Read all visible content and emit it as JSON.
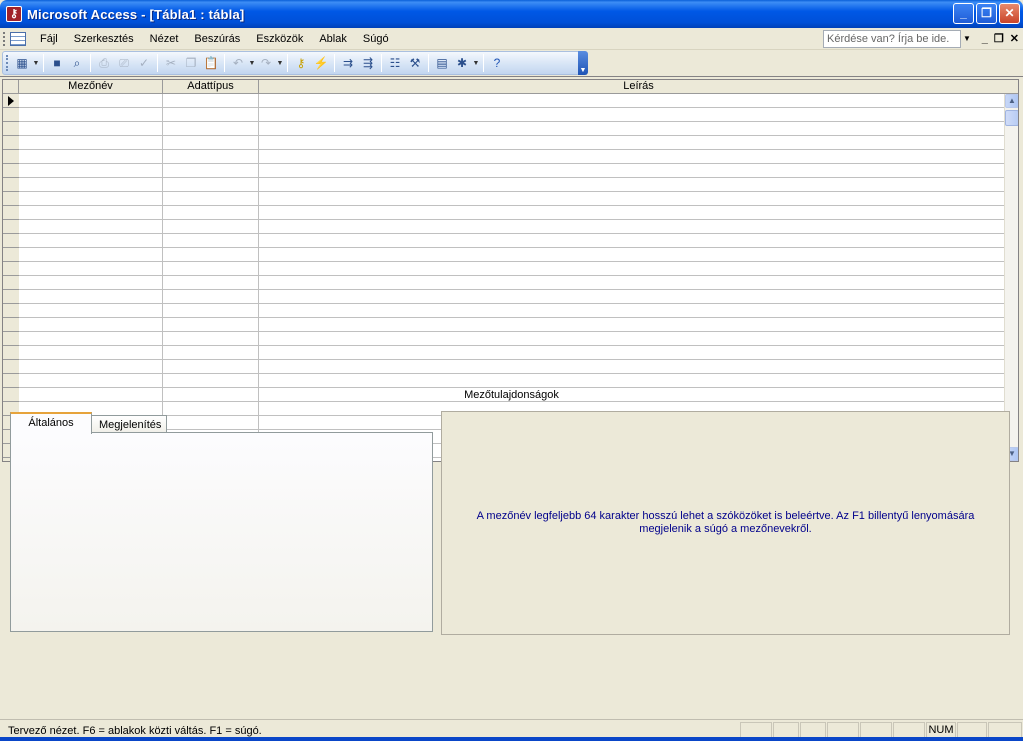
{
  "window": {
    "title": "Microsoft Access - [Tábla1 : tábla]",
    "minimize_label": "_",
    "restore_label": "❐",
    "close_label": "✕"
  },
  "menu": {
    "items": [
      {
        "label": "Fájl"
      },
      {
        "label": "Szerkesztés"
      },
      {
        "label": "Nézet"
      },
      {
        "label": "Beszúrás"
      },
      {
        "label": "Eszközök"
      },
      {
        "label": "Ablak"
      },
      {
        "label": "Súgó"
      }
    ],
    "help_placeholder": "Kérdése van? Írja be ide.",
    "mdi_minimize": "_",
    "mdi_restore": "❐",
    "mdi_close": "✕"
  },
  "toolbar": {
    "icons": [
      "view-icon",
      "save-icon",
      "search-icon",
      "print-icon",
      "print-preview-icon",
      "spelling-icon",
      "cut-icon",
      "copy-icon",
      "paste-icon",
      "undo-icon",
      "redo-icon",
      "primary-key-icon",
      "indexes-icon",
      "insert-rows-icon",
      "delete-rows-icon",
      "properties-icon",
      "build-icon",
      "database-window-icon",
      "new-object-icon",
      "help-icon"
    ]
  },
  "grid": {
    "columns": [
      "Mezőnév",
      "Adattípus",
      "Leírás"
    ]
  },
  "properties": {
    "title": "Mezőtulajdonságok",
    "tabs": [
      {
        "label": "Általános",
        "active": true
      },
      {
        "label": "Megjelenítés",
        "active": false
      }
    ],
    "description": "A mezőnév legfeljebb 64 karakter hosszú lehet a szóközöket is beleértve. Az F1 billentyű lenyomására megjelenik a súgó a mezőnevekről."
  },
  "status": {
    "text": "Tervező nézet. F6 = ablakok közti váltás. F1 = súgó.",
    "num": "NUM"
  },
  "colors": {
    "title_bar": "#0058e6",
    "description_text": "#00008b",
    "active_tab_accent": "#e6a33b"
  }
}
